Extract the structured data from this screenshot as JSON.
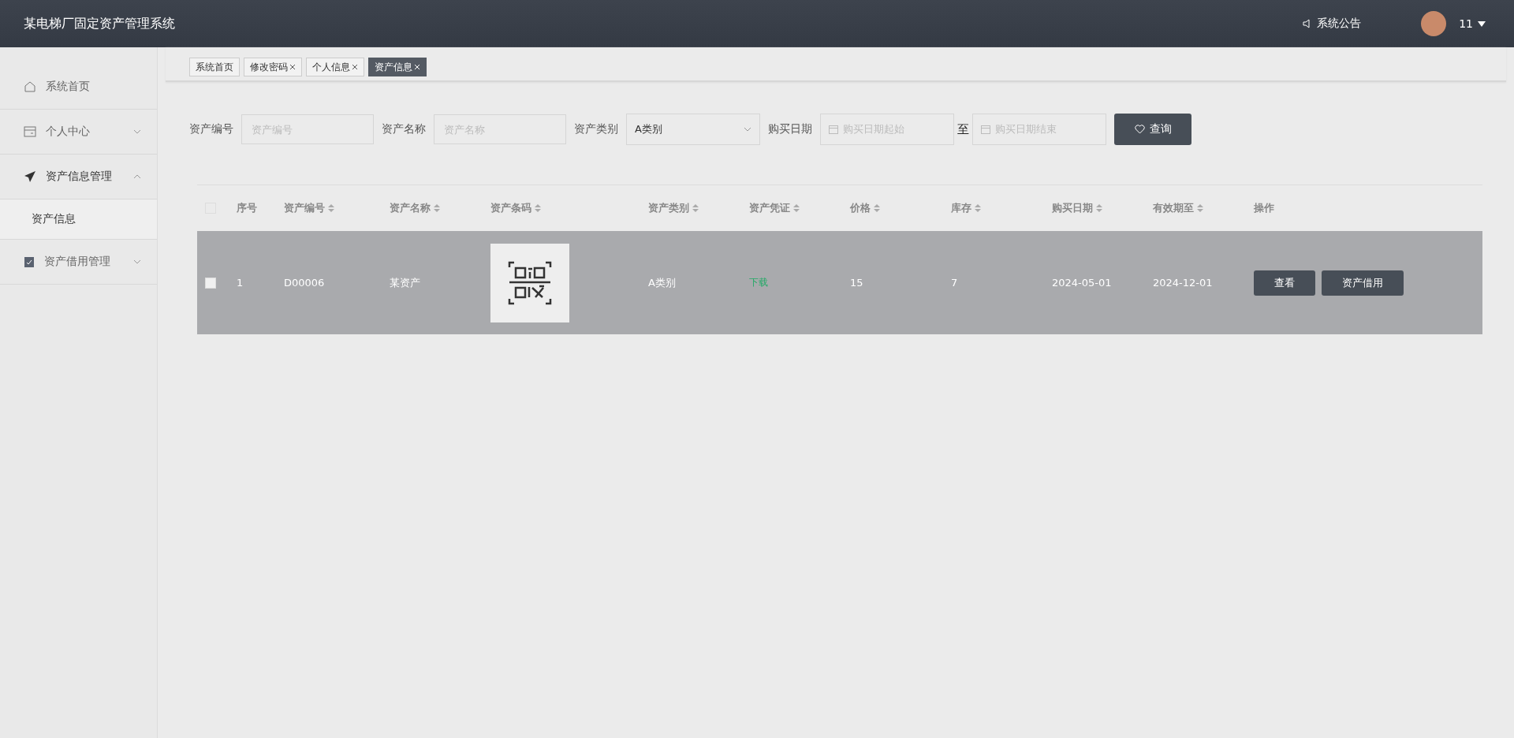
{
  "header": {
    "title": "某电梯厂固定资产管理系统",
    "notice": "系统公告",
    "user": "11"
  },
  "sidebar": {
    "items": [
      {
        "label": "系统首页"
      },
      {
        "label": "个人中心",
        "expanded": false
      },
      {
        "label": "资产信息管理",
        "expanded": true,
        "children": [
          {
            "label": "资产信息",
            "selected": true
          }
        ]
      },
      {
        "label": "资产借用管理",
        "expanded": false
      }
    ]
  },
  "tabs": [
    {
      "label": "系统首页",
      "closable": false,
      "selected": false
    },
    {
      "label": "修改密码",
      "closable": true,
      "selected": false
    },
    {
      "label": "个人信息",
      "closable": true,
      "selected": false
    },
    {
      "label": "资产信息",
      "closable": true,
      "selected": true
    }
  ],
  "search": {
    "fields": [
      {
        "kind": "text",
        "label": "资产编号",
        "placeholder": "资产编号"
      },
      {
        "kind": "text",
        "label": "资产名称",
        "placeholder": "资产名称"
      },
      {
        "kind": "select",
        "label": "资产类别",
        "value": "A类别"
      },
      {
        "kind": "daterange",
        "label": "购买日期",
        "start_placeholder": "购买日期起始",
        "separator": "至",
        "end_placeholder": "购买日期结束"
      }
    ],
    "button": "查询"
  },
  "table": {
    "columns": [
      {
        "label": "序号",
        "sortable": false
      },
      {
        "label": "资产编号",
        "sortable": true
      },
      {
        "label": "资产名称",
        "sortable": true
      },
      {
        "label": "资产条码",
        "sortable": true
      },
      {
        "label": "资产类别",
        "sortable": true
      },
      {
        "label": "资产凭证",
        "sortable": true
      },
      {
        "label": "价格",
        "sortable": true
      },
      {
        "label": "库存",
        "sortable": true
      },
      {
        "label": "购买日期",
        "sortable": true
      },
      {
        "label": "有效期至",
        "sortable": true
      },
      {
        "label": "操作",
        "sortable": false
      }
    ],
    "header_checked": false,
    "rows": [
      {
        "checked": false,
        "selected": true,
        "index": "1",
        "code": "D00006",
        "name": "某资产",
        "category": "A类别",
        "voucher": "下载",
        "price": "15",
        "stock": "7",
        "purchase_date": "2024-05-01",
        "valid_until": "2024-12-01",
        "actions": [
          "查看",
          "资产借用"
        ]
      }
    ]
  }
}
